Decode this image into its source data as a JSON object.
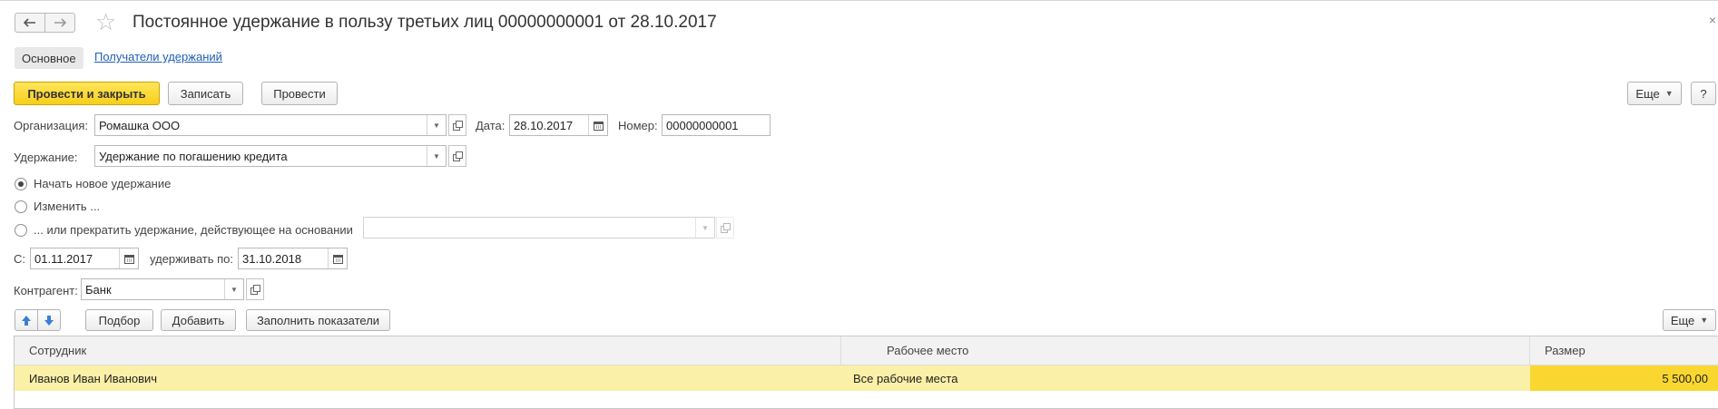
{
  "window": {
    "title": "Постоянное удержание в пользу третьих лиц 00000000001 от 28.10.2017",
    "close_glyph": "×"
  },
  "tabs": {
    "main": "Основное",
    "recipients": "Получатели удержаний"
  },
  "toolbar": {
    "post_close": "Провести и закрыть",
    "save": "Записать",
    "post": "Провести",
    "more": "Еще",
    "help": "?"
  },
  "form": {
    "org_label": "Организация:",
    "org_value": "Ромашка ООО",
    "date_label": "Дата:",
    "date_value": "28.10.2017",
    "number_label": "Номер:",
    "number_value": "00000000001",
    "deduction_label": "Удержание:",
    "deduction_value": "Удержание по погашению кредита",
    "radio_new": "Начать новое удержание",
    "radio_change": "Изменить ...",
    "radio_stop": "... или прекратить удержание, действующее на основании",
    "selected_radio": "radio_new",
    "from_label": "С:",
    "from_value": "01.11.2017",
    "until_label": "удерживать по:",
    "until_value": "31.10.2018",
    "counterparty_label": "Контрагент:",
    "counterparty_value": "Банк"
  },
  "table_toolbar": {
    "select": "Подбор",
    "add": "Добавить",
    "fill": "Заполнить показатели",
    "more": "Еще"
  },
  "table": {
    "columns": [
      "Сотрудник",
      "Рабочее место",
      "Размер"
    ],
    "rows": [
      {
        "employee": "Иванов Иван Иванович",
        "workplace": "Все рабочие места",
        "amount": "5 500,00"
      }
    ]
  },
  "colors": {
    "primary_button": "#f7cf1a",
    "selected_row": "#fbf0a8",
    "selected_cell": "#f9d730",
    "link": "#1f5fb5",
    "arrow_blue": "#3b7fd4"
  },
  "icons": [
    "back-arrow-icon",
    "forward-arrow-icon",
    "favorite-star-icon",
    "close-icon",
    "dropdown-arrow-icon",
    "open-icon",
    "calendar-icon",
    "move-up-icon",
    "move-down-icon"
  ]
}
